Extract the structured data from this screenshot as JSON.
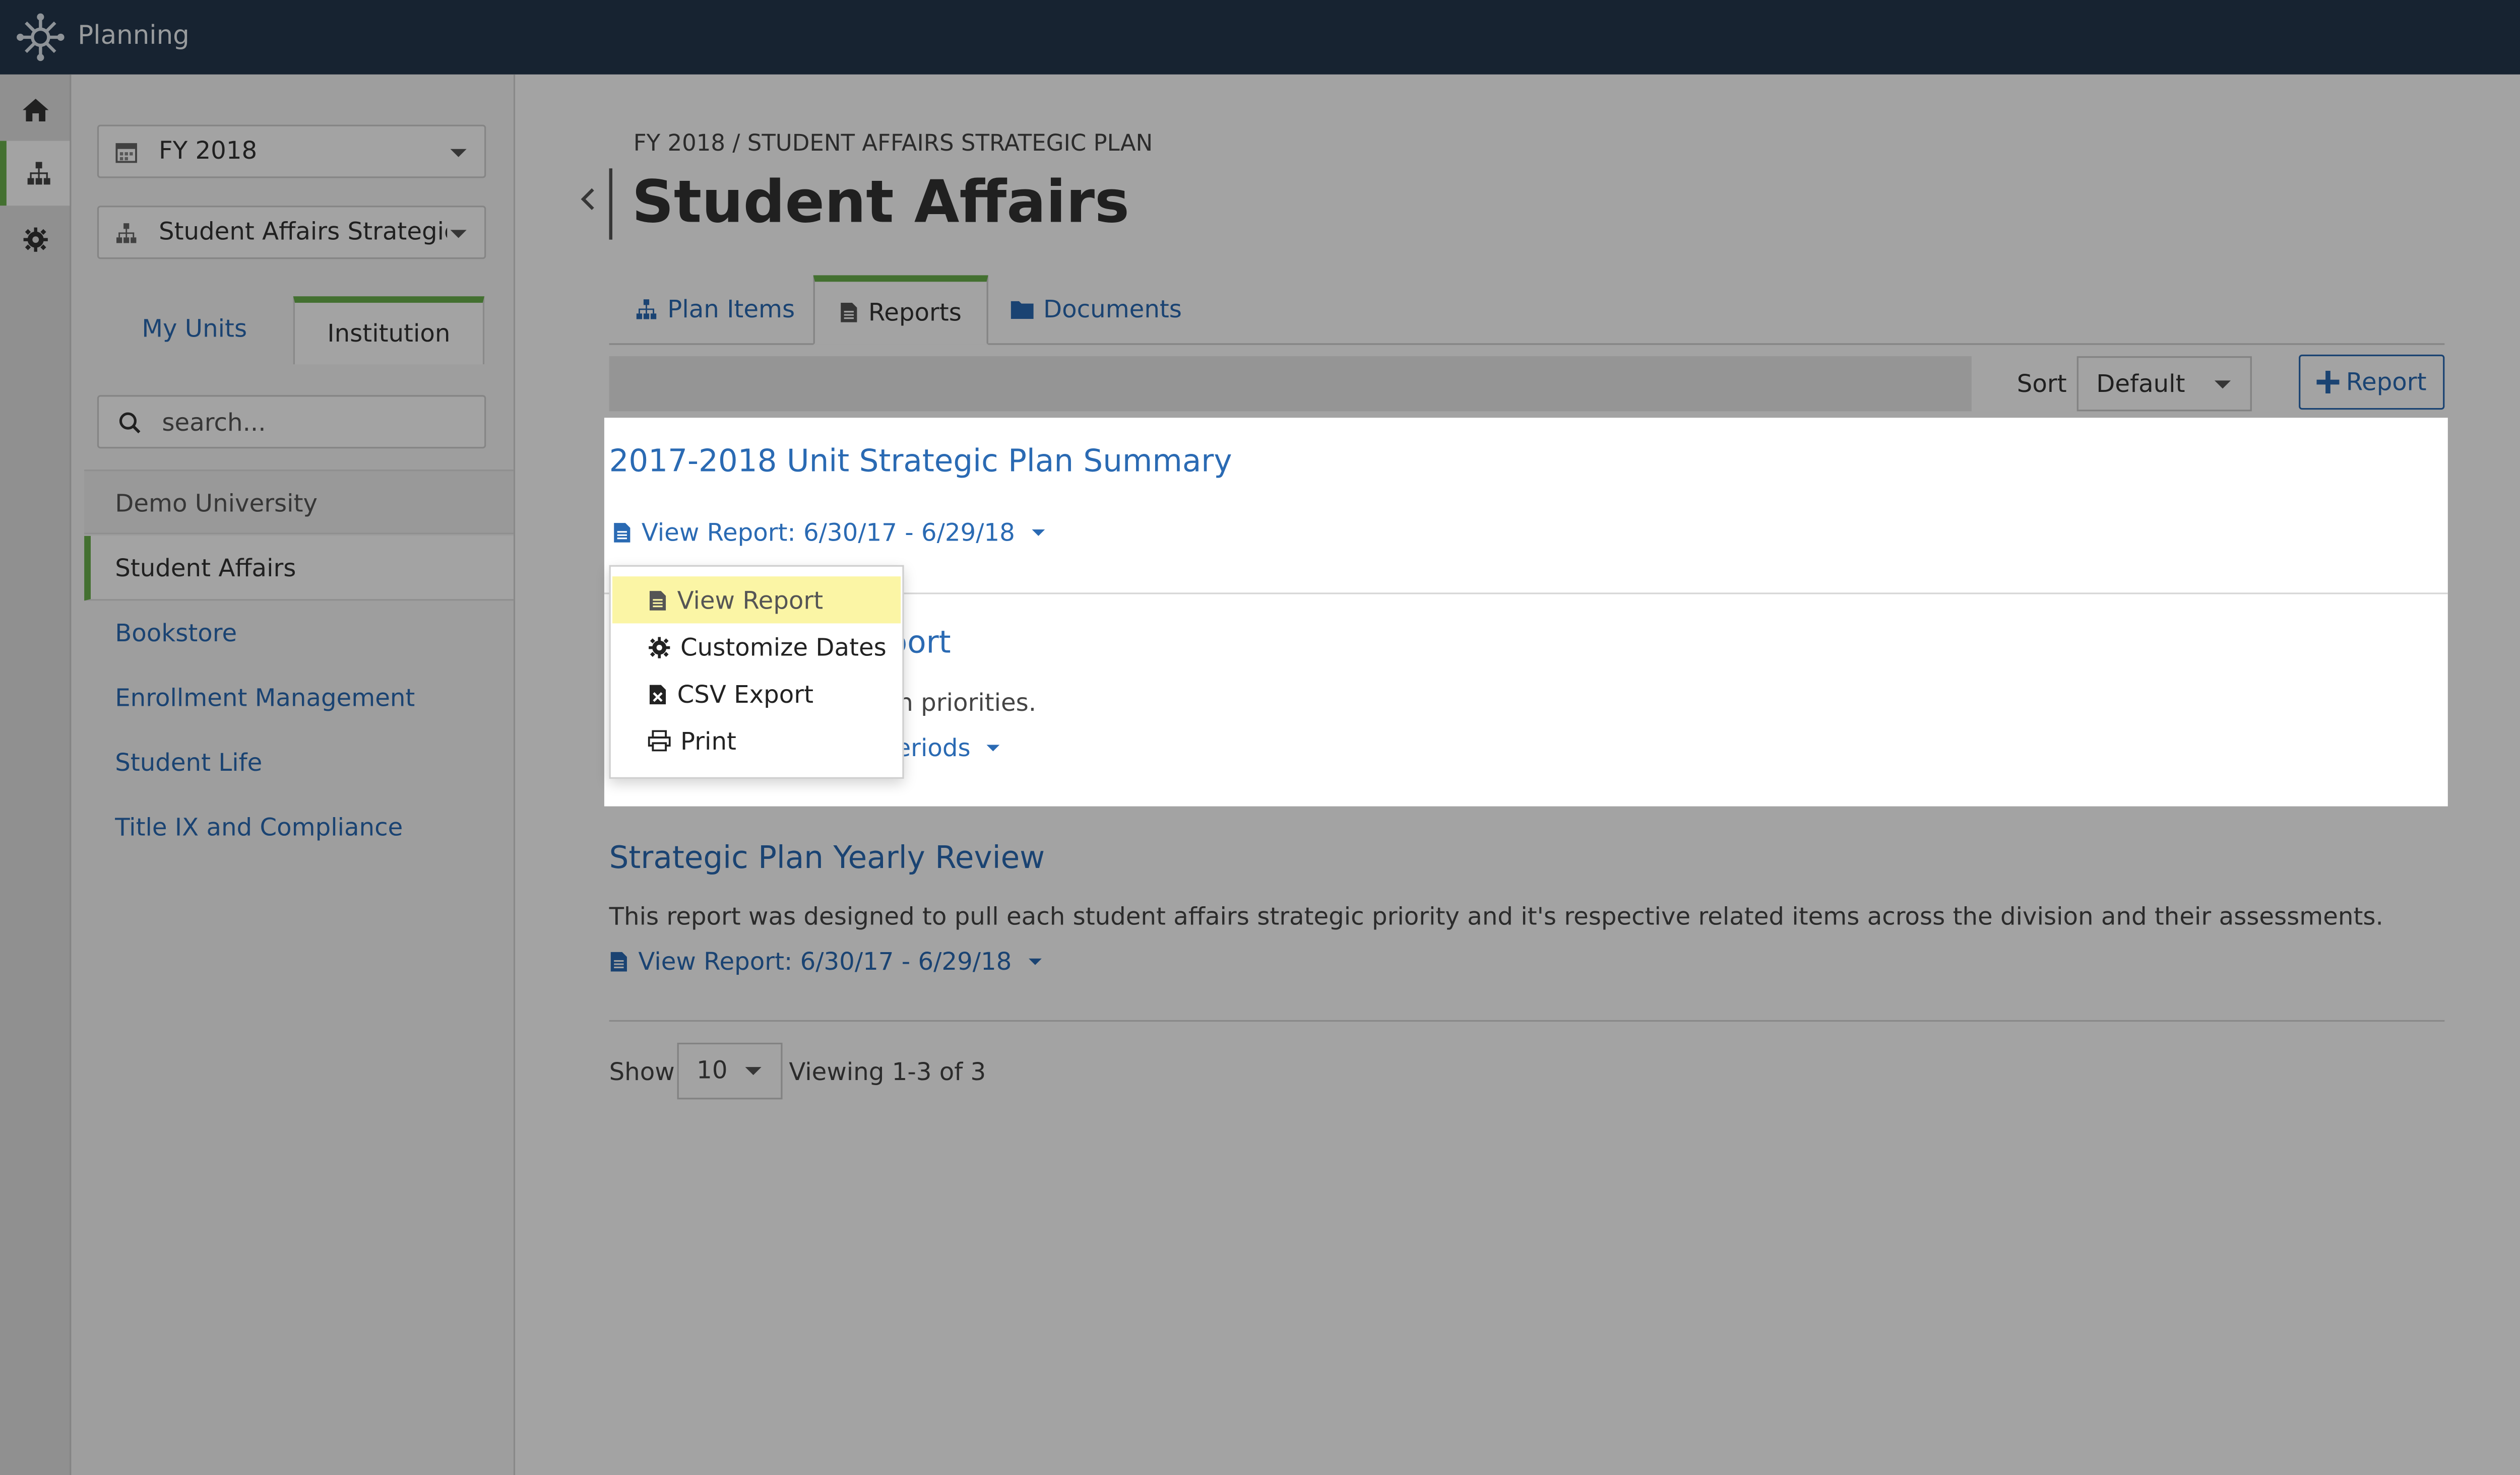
{
  "app": {
    "title": "Planning"
  },
  "sidebar": {
    "fiscal_year": "FY 2018",
    "plan": "Student Affairs Strategic Plan",
    "toggle": {
      "my_units": "My Units",
      "institution": "Institution"
    },
    "search_placeholder": "search...",
    "units": [
      "Demo University",
      "Student Affairs",
      "Bookstore",
      "Enrollment Management",
      "Student Life",
      "Title IX and Compliance"
    ]
  },
  "main": {
    "breadcrumb": "FY 2018 / STUDENT AFFAIRS STRATEGIC PLAN",
    "title": "Student Affairs",
    "tabs": [
      "Plan Items",
      "Reports",
      "Documents"
    ],
    "sort_label": "Sort",
    "sort_value": "Default",
    "add_report": "Report",
    "reports": [
      {
        "title": "2017-2018 Unit Strategic Plan Summary",
        "description": "",
        "link": "View Report: 6/30/17 - 6/29/18"
      },
      {
        "title_fragment": "port",
        "description_fragment": "on priorities.",
        "link_fragment": "eriods"
      },
      {
        "title": "Strategic Plan Yearly Review",
        "description": "This report was designed to pull each student affairs strategic priority and it's respective related items across the division and their assessments.",
        "link": "View Report: 6/30/17 - 6/29/18"
      }
    ],
    "pagination": {
      "show_label": "Show",
      "page_size": "10",
      "viewing": "Viewing 1-3 of 3"
    }
  },
  "dropdown": {
    "items": [
      "View Report",
      "Customize Dates",
      "CSV Export",
      "Print"
    ]
  },
  "colors": {
    "topbar": "#24384e",
    "accent_green": "#6ab04c",
    "link_blue": "#2a6ab3",
    "highlight": "#fbf5a5"
  }
}
